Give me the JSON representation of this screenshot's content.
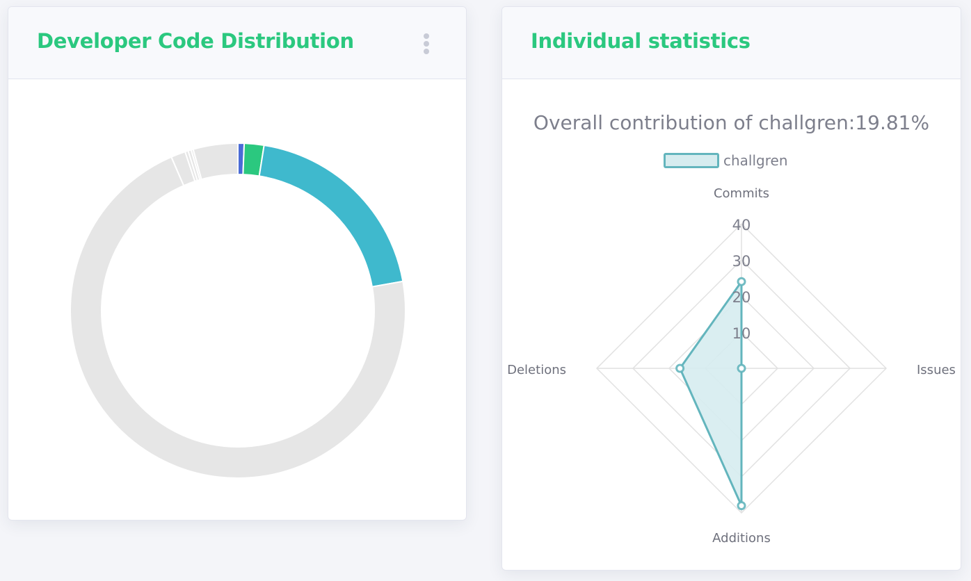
{
  "left_card": {
    "title": "Developer Code Distribution",
    "menu_icon": "vertical-ellipsis-icon"
  },
  "right_card": {
    "title": "Individual statistics",
    "chart_title_prefix": "Overall contribution of challgren:",
    "chart_title_value": "19.81%",
    "legend_label": "challgren"
  },
  "colors": {
    "accent": "#2bc87f",
    "radar_line": "#63b5bd",
    "radar_fill": "#d6ecef",
    "donut_rest": "#e6e6e6"
  },
  "chart_data": [
    {
      "type": "pie",
      "style": "donut",
      "start_angle_deg": 0,
      "slices": [
        {
          "value": 0.6,
          "color": "#4a6bd6"
        },
        {
          "value": 1.9,
          "color": "#2bc87f"
        },
        {
          "value": 19.7,
          "color": "#3fb9cd"
        },
        {
          "value": 71.3,
          "color": "#e6e6e6"
        },
        {
          "value": 1.4,
          "color": "#e6e6e6"
        },
        {
          "value": 0.3,
          "color": "#e6e6e6"
        },
        {
          "value": 0.3,
          "color": "#e6e6e6"
        },
        {
          "value": 0.2,
          "color": "#e6e6e6"
        },
        {
          "value": 4.3,
          "color": "#e6e6e6"
        }
      ]
    },
    {
      "type": "radar",
      "title": "Overall contribution of challgren:19.81%",
      "indicators": [
        "Commits",
        "Issues",
        "Additions",
        "Deletions"
      ],
      "radial_ticks": [
        10,
        20,
        30,
        40
      ],
      "rmax": 40,
      "series": [
        {
          "name": "challgren",
          "values": [
            24,
            0,
            38,
            17
          ]
        }
      ]
    }
  ]
}
